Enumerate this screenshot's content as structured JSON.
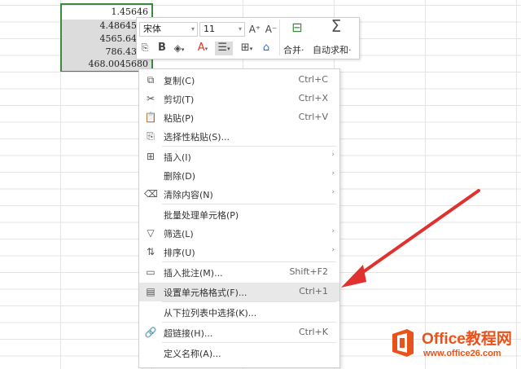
{
  "cells": [
    "1.45646",
    "4.4864545",
    "4565.6456",
    "786.4313",
    "468.0045680"
  ],
  "mini_toolbar": {
    "font_name": "宋体",
    "font_size": "11",
    "grow_font": "A⁺",
    "shrink_font": "A⁻",
    "bold": "B",
    "merge_label": "合并·",
    "autosum_label": "自动求和·"
  },
  "menu": {
    "items": [
      {
        "label": "复制(C)",
        "shortcut": "Ctrl+C",
        "icon": "copy-icon",
        "arrow": false
      },
      {
        "label": "剪切(T)",
        "shortcut": "Ctrl+X",
        "icon": "scissors-icon",
        "arrow": false
      },
      {
        "label": "粘贴(P)",
        "shortcut": "Ctrl+V",
        "icon": "paste-icon",
        "arrow": false
      },
      {
        "label": "选择性粘贴(S)...",
        "shortcut": "",
        "icon": "paste-special-icon",
        "arrow": false
      },
      {
        "label": "插入(I)",
        "shortcut": "",
        "icon": "insert-icon",
        "arrow": true
      },
      {
        "label": "删除(D)",
        "shortcut": "",
        "icon": "",
        "arrow": true
      },
      {
        "label": "清除内容(N)",
        "shortcut": "",
        "icon": "eraser-icon",
        "arrow": true
      },
      {
        "label": "批量处理单元格(P)",
        "shortcut": "",
        "icon": "",
        "arrow": false
      },
      {
        "label": "筛选(L)",
        "shortcut": "",
        "icon": "filter-icon",
        "arrow": true
      },
      {
        "label": "排序(U)",
        "shortcut": "",
        "icon": "sort-icon",
        "arrow": true
      },
      {
        "label": "插入批注(M)...",
        "shortcut": "Shift+F2",
        "icon": "comment-icon",
        "arrow": false
      },
      {
        "label": "设置单元格格式(F)...",
        "shortcut": "Ctrl+1",
        "icon": "format-cells-icon",
        "arrow": false
      },
      {
        "label": "从下拉列表中选择(K)...",
        "shortcut": "",
        "icon": "",
        "arrow": false
      },
      {
        "label": "超链接(H)...",
        "shortcut": "Ctrl+K",
        "icon": "link-icon",
        "arrow": false
      },
      {
        "label": "定义名称(A)...",
        "shortcut": "",
        "icon": "",
        "arrow": false
      }
    ],
    "highlighted_index": 11
  },
  "watermark": {
    "brand": "Office教程网",
    "url": "www.office26.com",
    "color": "#e8531c"
  },
  "colors": {
    "selection_border": "#3b8a3e",
    "arrow": "#e0312f"
  }
}
